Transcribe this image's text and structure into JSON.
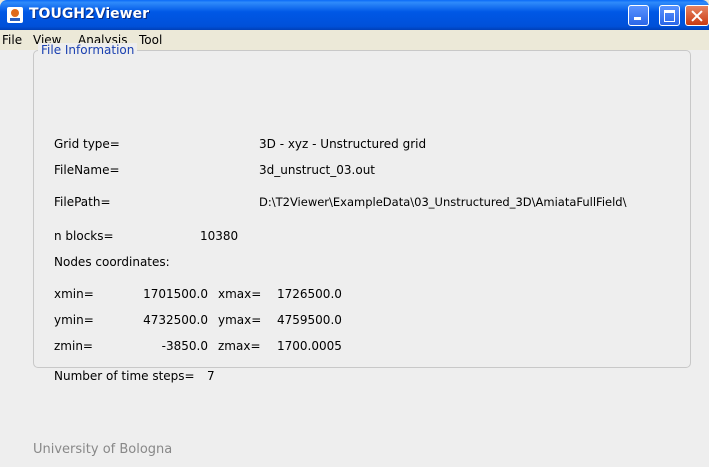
{
  "window": {
    "title": "TOUGH2Viewer"
  },
  "menu": [
    "File",
    "View",
    "Analysis",
    "Tool"
  ],
  "group": {
    "title": "File Information"
  },
  "info": {
    "grid_type_label": "Grid type=",
    "grid_type_value": "3D - xyz - Unstructured grid",
    "filename_label": "FileName=",
    "filename_value": "3d_unstruct_03.out",
    "filepath_label": "FilePath=",
    "filepath_value": "D:\\T2Viewer\\ExampleData\\03_Unstructured_3D\\AmiataFullField\\",
    "nblocks_label": "n blocks=",
    "nblocks_value": "10380",
    "nodes_label": "Nodes coordinates:",
    "xmin_label": "xmin=",
    "xmin_value": "1701500.0",
    "xmax_label": "xmax=",
    "xmax_value": "1726500.0",
    "ymin_label": "ymin=",
    "ymin_value": "4732500.0",
    "ymax_label": "ymax=",
    "ymax_value": "4759500.0",
    "zmin_label": "zmin=",
    "zmin_value": "-3850.0",
    "zmax_label": "zmax=",
    "zmax_value": "1700.0005",
    "timesteps_label": "Number of time steps=",
    "timesteps_value": "7"
  },
  "status": {
    "text": "University of Bologna"
  }
}
